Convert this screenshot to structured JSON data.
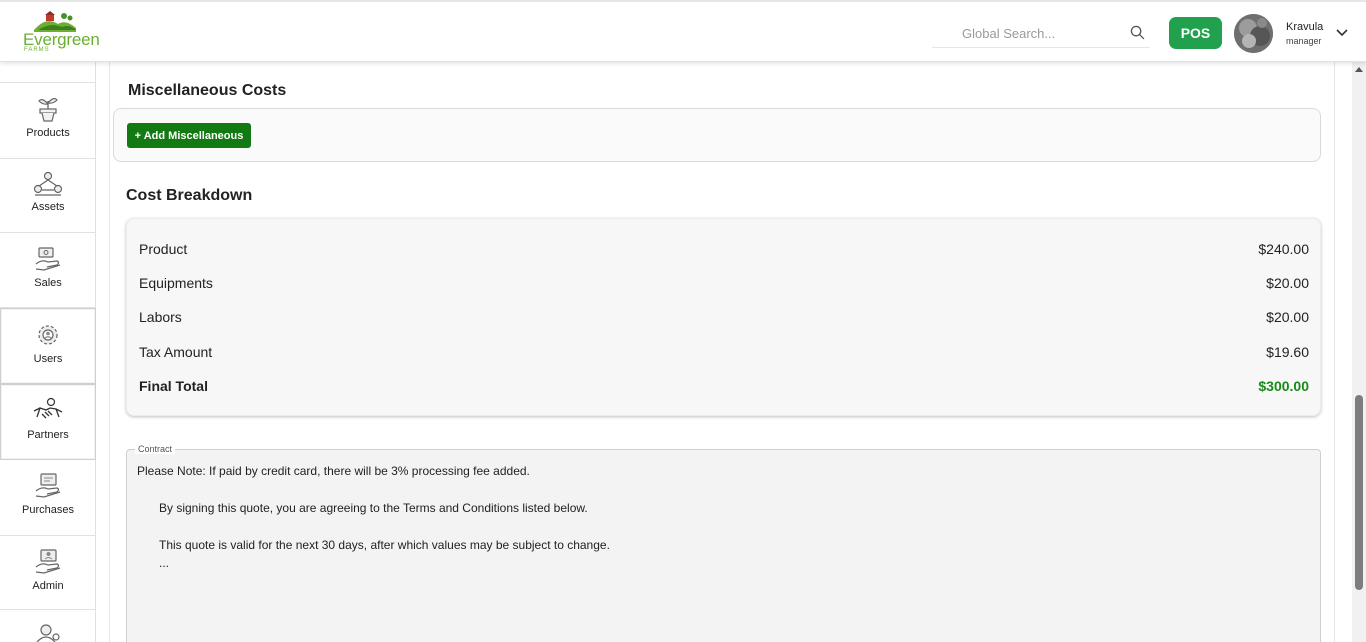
{
  "header": {
    "brand": "Evergreen",
    "brand_sub": "FARMS",
    "search_placeholder": "Global Search...",
    "pos_label": "POS",
    "user_name": "Kravula",
    "user_role": "manager"
  },
  "sidebar": {
    "items": [
      {
        "label": "Products",
        "icon": "plant-pot-icon"
      },
      {
        "label": "Assets",
        "icon": "assets-network-icon"
      },
      {
        "label": "Sales",
        "icon": "sales-hand-icon"
      },
      {
        "label": "Users",
        "icon": "users-gear-icon"
      },
      {
        "label": "Partners",
        "icon": "handshake-icon"
      },
      {
        "label": "Purchases",
        "icon": "purchases-hand-icon"
      },
      {
        "label": "Admin",
        "icon": "admin-hand-icon"
      }
    ]
  },
  "misc": {
    "title": "Miscellaneous Costs",
    "add_label": "+ Add Miscellaneous"
  },
  "breakdown": {
    "title": "Cost Breakdown",
    "rows": [
      {
        "label": "Product",
        "value": "$240.00"
      },
      {
        "label": "Equipments",
        "value": "$20.00"
      },
      {
        "label": "Labors",
        "value": "$20.00"
      },
      {
        "label": "Tax Amount",
        "value": "$19.60"
      }
    ],
    "total_label": "Final Total",
    "total_value": "$300.00",
    "total_color": "#1a8a1a"
  },
  "contract": {
    "legend": "Contract",
    "line1": "Please Note: If paid by credit card, there will be 3% processing fee added.",
    "line2": "By signing this quote, you are agreeing to the Terms and Conditions listed below.",
    "line3": "This quote is valid for the next 30 days, after which values may be subject to change.",
    "line4": "..."
  },
  "colors": {
    "accent_green": "#21a04d",
    "button_green": "#137a13",
    "logo_green": "#6bb032"
  }
}
